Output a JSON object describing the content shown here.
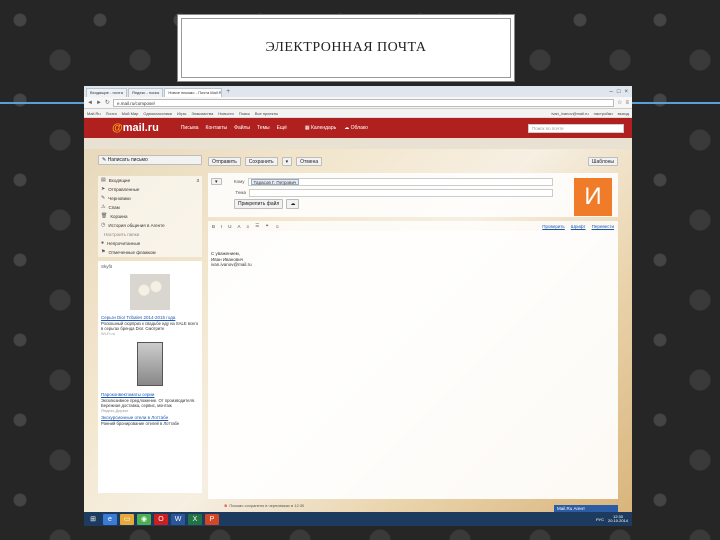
{
  "slide": {
    "title": "ЭЛЕКТРОННАЯ ПОЧТА"
  },
  "browser": {
    "tabs": [
      "Входящие - почта",
      "Яндекс - поиск",
      "Новое письмо - Почта Mail.Ru"
    ],
    "active_tab": 2,
    "new_tab": "+",
    "url": "e.mail.ru/compose/",
    "bookmarks": [
      "Mail.Ru",
      "Почта",
      "Мой Мир",
      "Одноклассники",
      "Игры",
      "Знакомства",
      "Новости",
      "Поиск",
      "Все проекты"
    ],
    "user": "ivan_ivanov@mail.ru",
    "header_links": [
      "настройки",
      "выход"
    ]
  },
  "mail": {
    "logo_at": "@",
    "logo_text": "mail.ru",
    "nav": [
      "Письма",
      "Контакты",
      "Файлы",
      "Темы",
      "Ещё"
    ],
    "calendar": "Календарь",
    "cloud": "Облако",
    "search_placeholder": "Поиск по почте",
    "write_button": "Написать письмо",
    "folders": [
      {
        "icon": "inbox-icon",
        "label": "Входящие",
        "count": "3"
      },
      {
        "icon": "sent-icon",
        "label": "Отправленные",
        "count": ""
      },
      {
        "icon": "draft-icon",
        "label": "Черновики",
        "count": ""
      },
      {
        "icon": "spam-icon",
        "label": "Спам",
        "count": ""
      },
      {
        "icon": "trash-icon",
        "label": "Корзина",
        "count": ""
      },
      {
        "icon": "history-icon",
        "label": "История общения в Агенте",
        "count": ""
      }
    ],
    "folders_settings": "Настроить папки",
    "extra_folders": [
      {
        "label": "Непрочитанные"
      },
      {
        "label": "Отмеченные флажком"
      }
    ],
    "ad": {
      "title": "Skyfit",
      "items": [
        {
          "link": "Серьги Dior Tribales 2014-2015 года",
          "text": "Роскошный сюрприз к свадьбе иду на SALE всего в серьгах бренда Dior. Смотрите",
          "source": "Wi-Fi.ru"
        },
        {
          "link": "Пароконвектоматы серии",
          "text": "Эксклюзивное предложение. От производителя. Бережная доставка, сервис, монтаж",
          "source": "Яндекс.Директ"
        },
        {
          "link": "Экскурсионные отели в Лоттабе",
          "text": "Ранний бронирование отелей в Лоттабе",
          "source": ""
        }
      ]
    },
    "toolbar": {
      "send": "Отправить",
      "save": "Сохранить",
      "save_arrow": "▾",
      "cancel": "Отмена",
      "design": "Шаблоны"
    },
    "compose": {
      "to_label": "Кому",
      "to_value": "Тарасов Г. Петрович",
      "subject_label": "Тема",
      "subject_value": "",
      "attach_button": "Прикрепить файл",
      "avatar_letter": "И",
      "editor_links": [
        "Проверить",
        "Шрифт",
        "Перевести"
      ],
      "body_lines": [
        "С уважением,",
        "Иван Иванович",
        "ivan.ivanov@mail.ru"
      ]
    },
    "notice": "Письмо сохранено в черновиках в 12:30",
    "agent_label": "Mail.Ru Агент"
  },
  "taskbar": {
    "apps": [
      {
        "icon": "windows-start-icon",
        "color": "#1d3b5e"
      },
      {
        "icon": "ie-icon",
        "color": "#3a7bd5"
      },
      {
        "icon": "explorer-icon",
        "color": "#e6a93c"
      },
      {
        "icon": "chrome-icon",
        "color": "#4caf50"
      },
      {
        "icon": "opera-icon",
        "color": "#cc1f1f"
      },
      {
        "icon": "word-icon",
        "color": "#2b579a"
      },
      {
        "icon": "excel-icon",
        "color": "#217346"
      },
      {
        "icon": "powerpoint-icon",
        "color": "#d24726"
      }
    ],
    "lang": "РУС",
    "time": "12:30",
    "date": "20.10.2014"
  }
}
